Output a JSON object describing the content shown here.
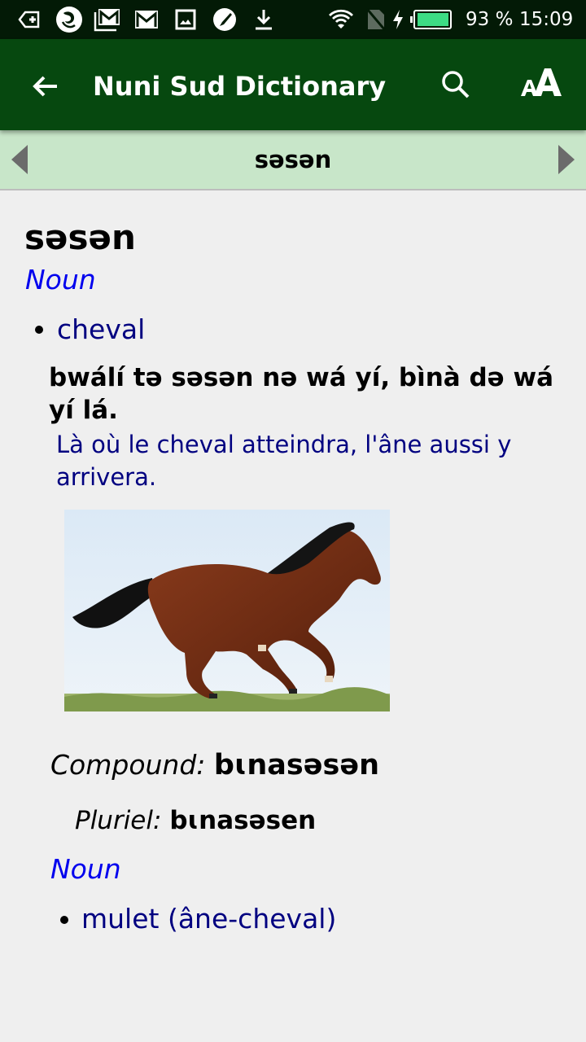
{
  "status_bar": {
    "left_icons": [
      "keyboard-backspace-icon",
      "phoenix-app-icon",
      "gmail-multiple-icon",
      "gmail-icon",
      "image-icon",
      "paintbrush-icon",
      "download-icon"
    ],
    "right_icons": [
      "wifi-icon",
      "no-sim-icon",
      "charging-bolt-icon",
      "battery-icon"
    ],
    "battery_level": "93 %",
    "battery_fraction": 0.93,
    "battery_color": "#3ddc84",
    "time": "15:09"
  },
  "app_bar": {
    "title": "Nuni Sud Dictionary",
    "background": "#06480f",
    "actions": [
      "search-icon",
      "text-size-icon"
    ]
  },
  "entry_nav": {
    "current_word": "səsən",
    "background": "#c8e6c9"
  },
  "entry": {
    "headword": "səsən",
    "senses": [
      {
        "part_of_speech": "Noun",
        "gloss": "cheval",
        "example": "bwálí tə səsən nə wá yí, bìnà də wá yí lá.",
        "example_translation": "Là où le cheval atteindra, l'âne aussi y arrivera.",
        "picture": "galloping brown horse"
      }
    ],
    "compound": {
      "label": "Compound:",
      "form": "bɩnasəsən",
      "plural_label": "Pluriel:",
      "plural_form": "bɩnasəsen",
      "part_of_speech": "Noun",
      "gloss": "mulet (âne-cheval)"
    }
  }
}
